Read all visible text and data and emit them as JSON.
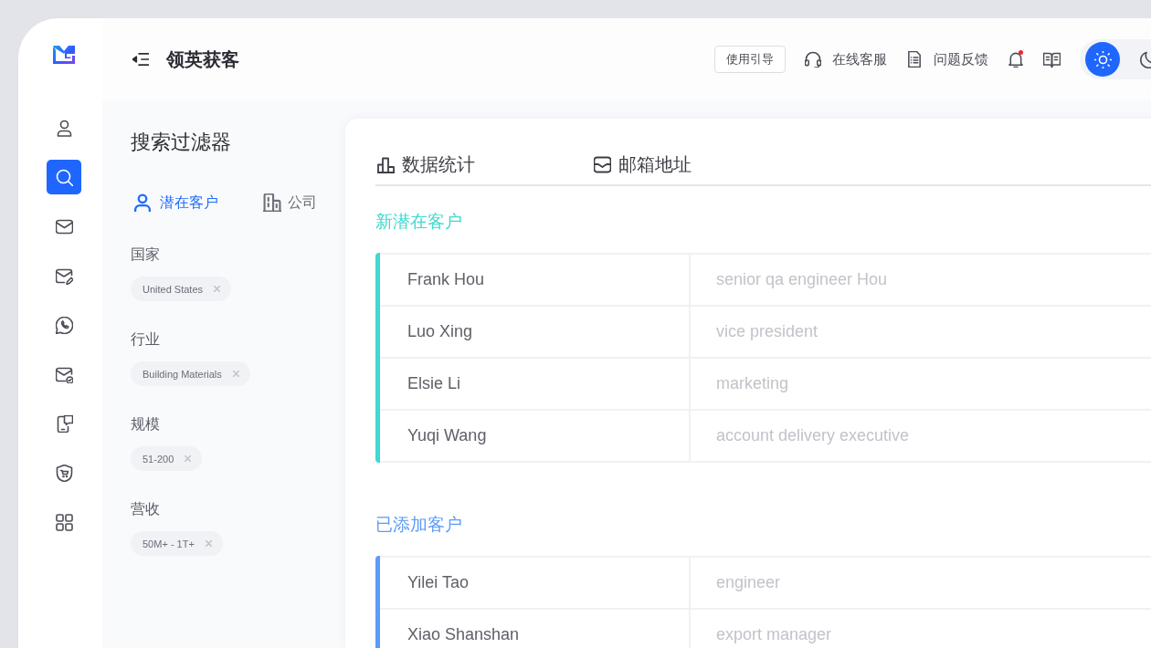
{
  "sidebar": {
    "items": [
      {
        "selected": false
      },
      {
        "selected": true
      },
      {
        "selected": false
      },
      {
        "selected": false
      },
      {
        "selected": false
      },
      {
        "selected": false
      },
      {
        "selected": false
      },
      {
        "selected": false
      },
      {
        "selected": false
      }
    ]
  },
  "header": {
    "title": "领英获客",
    "guide_button": "使用引导",
    "links": [
      {
        "label": "在线客服"
      },
      {
        "label": "问题反馈"
      }
    ],
    "notifications_unread": true,
    "theme_options": [
      {
        "selected": true
      },
      {
        "selected": false
      }
    ]
  },
  "filter_panel": {
    "title": "搜索过滤器",
    "tabs": [
      {
        "label": "潜在客户",
        "selected": true
      },
      {
        "label": "公司",
        "selected": false
      }
    ],
    "filters": [
      {
        "label": "国家",
        "tags": [
          "United States"
        ]
      },
      {
        "label": "行业",
        "tags": [
          "Building Materials"
        ]
      },
      {
        "label": "规模",
        "tags": [
          "51-200"
        ]
      },
      {
        "label": "营收",
        "tags": [
          "50M+ - 1T+"
        ]
      }
    ]
  },
  "main": {
    "tabs": [
      {
        "label": "数据统计"
      },
      {
        "label": "邮箱地址"
      }
    ],
    "sections": [
      {
        "title": "新潜在客户",
        "color": "#3fd9cf",
        "rows": [
          {
            "name": "Frank Hou",
            "job_title": "senior qa engineer Hou"
          },
          {
            "name": "Luo Xing",
            "job_title": "vice president"
          },
          {
            "name": "Elsie Li",
            "job_title": "marketing"
          },
          {
            "name": "Yuqi Wang",
            "job_title": "account delivery executive"
          }
        ]
      },
      {
        "title": "已添加客户",
        "color": "#5b9cf8",
        "rows": [
          {
            "name": "Yilei Tao",
            "job_title": "engineer"
          },
          {
            "name": "Xiao Shanshan",
            "job_title": "export manager"
          }
        ]
      }
    ]
  }
}
